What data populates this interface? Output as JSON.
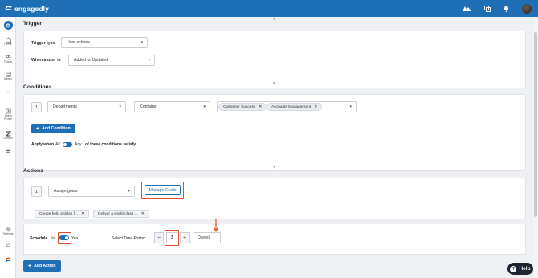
{
  "app": {
    "brand": "engagedly",
    "accent": "#1e6fb6",
    "topbar_icons": [
      "peaks-icon",
      "translate-icon",
      "bell-icon",
      "avatar"
    ]
  },
  "sidebar": {
    "items": [
      {
        "label": "",
        "icon": "workflow-icon",
        "active": true
      },
      {
        "label": "Home",
        "icon": "home-icon"
      },
      {
        "label": "Teams",
        "icon": "teams-icon"
      },
      {
        "label": "Admin",
        "icon": "admin-icon"
      },
      {
        "label": "",
        "icon": "more-icon"
      },
      {
        "label": "Talent Profile",
        "icon": "talent-icon"
      },
      {
        "label": "Growth",
        "icon": "growth-icon"
      },
      {
        "label": "",
        "icon": "menu-icon"
      },
      {
        "label": "Settings",
        "icon": "gear-icon"
      },
      {
        "label": "",
        "icon": "recycle-icon"
      },
      {
        "label": "",
        "icon": "brand-icon"
      }
    ]
  },
  "trigger": {
    "title": "Trigger",
    "trigger_type_label": "Trigger type",
    "trigger_type_value": "User actions",
    "when_label": "When a user is",
    "when_value": "Added or Updated"
  },
  "conditions": {
    "title": "Conditions",
    "row_number": "1",
    "field_value": "Departments",
    "operator_value": "Contains",
    "chips": [
      "Customer Success",
      "Accounts Management"
    ],
    "add_label": "Add Condition",
    "apply_when_label": "Apply when",
    "all_label": "All",
    "any_label": "Any",
    "apply_suffix": "of these conditions satisfy"
  },
  "actions": {
    "title": "Actions",
    "row_number": "1",
    "action_value": "Assign goals",
    "manage_label": "Manage Goals",
    "goal_chips": [
      "Create help articles f...",
      "Deliver a world-class ..."
    ],
    "schedule_label": "Schedule",
    "schedule_no": "No",
    "schedule_yes": "Yes",
    "schedule_enabled": true,
    "period_label": "Select Time Period:",
    "period_value": "3",
    "period_unit": "Day(s)",
    "add_action_label": "Add Action"
  },
  "help": {
    "label": "Help"
  }
}
